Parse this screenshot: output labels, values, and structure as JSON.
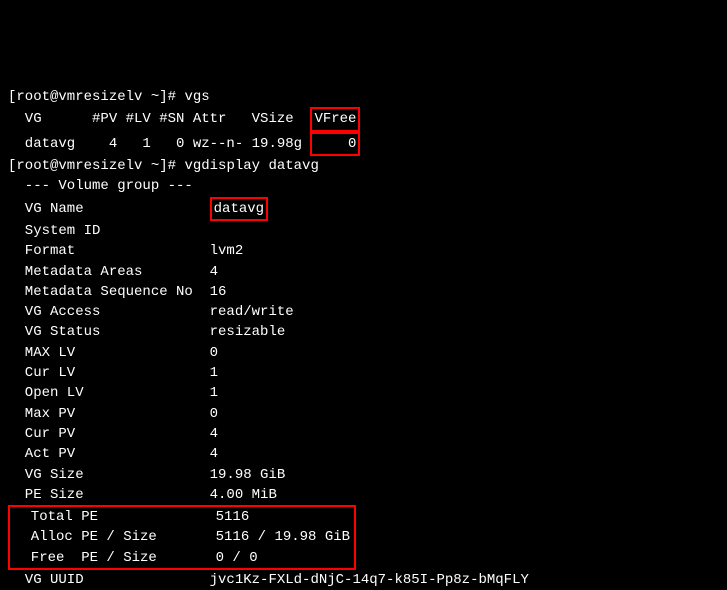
{
  "prompt1": "[root@vmresizelv ~]# ",
  "cmd1": "vgs",
  "vgs": {
    "headers_left": "  VG      #PV #LV #SN Attr   VSize  ",
    "header_vfree": "VFree",
    "row_left": "  datavg    4   1   0 wz--n- 19.98g ",
    "row_vfree": "    0"
  },
  "prompt2": "[root@vmresizelv ~]# ",
  "cmd2": "vgdisplay datavg",
  "vgdisplay": {
    "header": "  --- Volume group ---",
    "vg_name_label": "  VG Name               ",
    "vg_name_value": "datavg",
    "system_id": "  System ID             ",
    "format": "  Format                lvm2",
    "metadata_areas": "  Metadata Areas        4",
    "metadata_seq": "  Metadata Sequence No  16",
    "vg_access": "  VG Access             read/write",
    "vg_status": "  VG Status             resizable",
    "max_lv": "  MAX LV                0",
    "cur_lv": "  Cur LV                1",
    "open_lv": "  Open LV               1",
    "max_pv": "  Max PV                0",
    "cur_pv": "  Cur PV                4",
    "act_pv": "  Act PV                4",
    "vg_size": "  VG Size               19.98 GiB",
    "pe_size": "  PE Size               4.00 MiB",
    "total_pe": "  Total PE              5116",
    "alloc_pe": "  Alloc PE / Size       5116 / 19.98 GiB",
    "free_pe": "  Free  PE / Size       0 / 0",
    "vg_uuid": "  VG UUID               jvc1Kz-FXLd-dNjC-14q7-k85I-Pp8z-bMqFLY"
  }
}
